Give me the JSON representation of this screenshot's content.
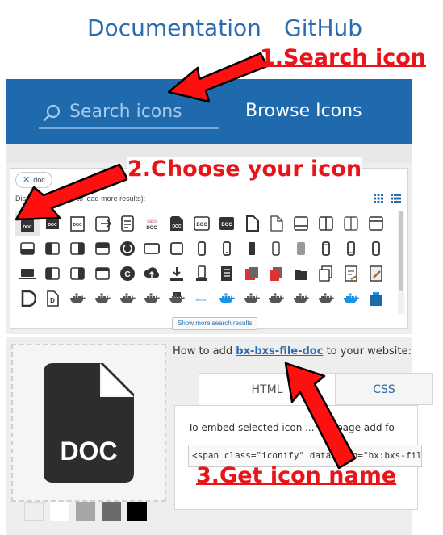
{
  "topnav": {
    "documentation": "Documentation",
    "github": "GitHub"
  },
  "banner": {
    "search_placeholder": "Search icons",
    "browse_label": "Browse Icons"
  },
  "search_panel": {
    "query_chip": "doc",
    "info_text": "Displaying ... page to load more results):",
    "show_more": "Show more search results",
    "icon_names": [
      "bxs-file-doc-icon",
      "doc-file-icon",
      "doc-file-outline-icon",
      "file-export-icon",
      "file-text-icon",
      "sass-doc-icon",
      "doc-file-dark-icon",
      "doc-box-icon",
      "doc-box-filled-icon",
      "file-filled-icon",
      "file-outline-icon",
      "window-bottom-icon",
      "window-split-icon",
      "window-split-outline-icon",
      "window-top-icon",
      "panel-bottom-icon",
      "panel-left-icon",
      "panel-right-icon",
      "panel-top-icon",
      "sync-doc-icon",
      "panel-wide-icon",
      "panel-box-icon",
      "phone-device-icon",
      "phone-device-2-icon",
      "phone-device-3-icon",
      "phone-device-4-icon",
      "tablet-gray-icon",
      "phone-device-5-icon",
      "phone-device-6-icon",
      "phone-device-7-icon",
      "laptop-icon",
      "tablet-left-icon",
      "tablet-right-icon",
      "window-thin-icon",
      "docs-c-icon",
      "cloud-upload-icon",
      "download-tray-icon",
      "phone-dock-icon",
      "book-stack-icon",
      "file-red-copy-icon",
      "file-red-copy-2-icon",
      "folder-copy-icon",
      "files-copy-icon",
      "doc-sign-icon",
      "doc-edit-icon",
      "d-letter-icon",
      "d-file-icon",
      "docker-gray-icon",
      "docker-gray-2-icon",
      "docker-gray-3-icon",
      "docker-gray-4-icon",
      "docker-stack-icon",
      "docker-text-icon",
      "docker-blue-icon",
      "docker-dark-icon",
      "docker-dark-2-icon",
      "docker-dark-3-icon",
      "docker-dark-4-icon",
      "docker-blue-2-icon",
      "docker-box-icon"
    ]
  },
  "detail": {
    "howto_prefix": "How to add ",
    "icon_name": "bx-bxs-file-doc",
    "howto_suffix": " to your website:",
    "tab_html": "HTML",
    "tab_css": "CSS",
    "embed_text": "To embed selected icon ... our page add fo",
    "code": "<span class=\"iconify\" data-icon=\"bx:bxs-file",
    "preview_label": "DOC",
    "swatches": [
      "#eeeeee",
      "#ffffff",
      "#a6a6a6",
      "#6b6b6b",
      "#000000"
    ]
  },
  "annotations": {
    "step1": "1.Search icon",
    "step2": "2.Choose your icon",
    "step3": "3.Get icon name"
  },
  "colors": {
    "brand_blue": "#1f6aad",
    "link_blue": "#2a6cb0",
    "annotation_red": "#e8141a"
  }
}
